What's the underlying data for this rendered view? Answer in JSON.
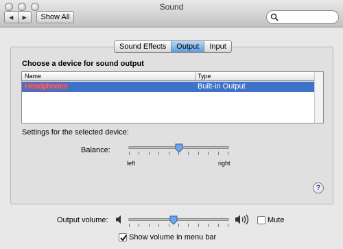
{
  "window": {
    "title": "Sound"
  },
  "toolbar": {
    "back_glyph": "◀",
    "forward_glyph": "▶",
    "show_all_label": "Show All",
    "search_placeholder": ""
  },
  "tabs": [
    {
      "label": "Sound Effects",
      "active": false
    },
    {
      "label": "Output",
      "active": true
    },
    {
      "label": "Input",
      "active": false
    }
  ],
  "output": {
    "choose_label": "Choose a device for sound output",
    "table": {
      "columns": [
        "Name",
        "Type"
      ],
      "rows": [
        {
          "name": "Headphones",
          "type": "Built-in Output",
          "selected": true
        }
      ]
    },
    "settings_label": "Settings for the selected device:",
    "balance": {
      "label": "Balance:",
      "left_label": "left",
      "right_label": "right",
      "value": 0.5
    },
    "help_label": "?"
  },
  "volume": {
    "label": "Output volume:",
    "value": 0.45,
    "mute_label": "Mute",
    "mute_checked": false,
    "show_in_menu_bar_label": "Show volume in menu bar",
    "show_in_menu_bar_checked": true
  },
  "colors": {
    "selection": "#3f72c9",
    "active_tab": "#5c9ce0",
    "highlight_text": "#ff6a6a"
  }
}
